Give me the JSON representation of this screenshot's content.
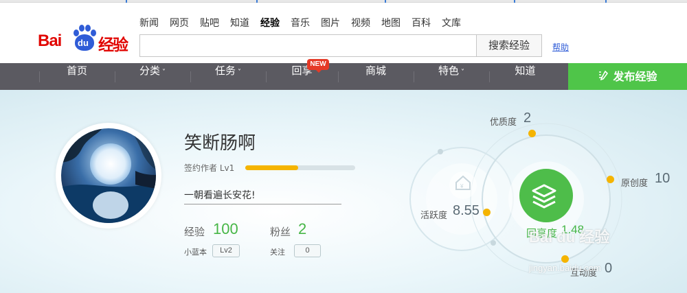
{
  "header": {
    "logo_text_bai": "Bai",
    "logo_text_du": "du",
    "logo_text_jingyan": "经验",
    "nav_links": [
      "新闻",
      "网页",
      "贴吧",
      "知道",
      "经验",
      "音乐",
      "图片",
      "视频",
      "地图",
      "百科",
      "文库"
    ],
    "active_link": "经验",
    "search": {
      "value": "",
      "button_label": "搜索经验"
    },
    "help_label": "帮助"
  },
  "menu": {
    "items": [
      "首页",
      "分类",
      "任务",
      "回享",
      "商城",
      "特色",
      "知道"
    ],
    "new_badge": "NEW",
    "caret": "˅",
    "publish_label": "发布经验",
    "accent_color": "#4fc549"
  },
  "profile": {
    "username": "笑断肠啊",
    "level_label": "签约作者 Lv1",
    "level_progress": 0.48,
    "motto": "一朝看遍长安花!",
    "stats": {
      "experience_label": "经验",
      "experience_value": "100",
      "fans_label": "粉丝",
      "fans_value": "2",
      "blue_label": "小蓝本",
      "blue_value": "Lv2",
      "follow_label": "关注",
      "follow_value": "0"
    }
  },
  "metrics": {
    "quality_label": "优质度",
    "quality_value": "2",
    "original_label": "原创度",
    "original_value": "10",
    "activity_label": "活跃度",
    "activity_value": "8.55",
    "share_label": "回享度",
    "share_value": "1.48",
    "interaction_label": "互动度",
    "interaction_value": "0",
    "center_icon": "layers-icon",
    "house_icon": "house-icon"
  },
  "watermark": {
    "brand": "Bai du 经验",
    "url": "jingyan.baidu.com"
  }
}
